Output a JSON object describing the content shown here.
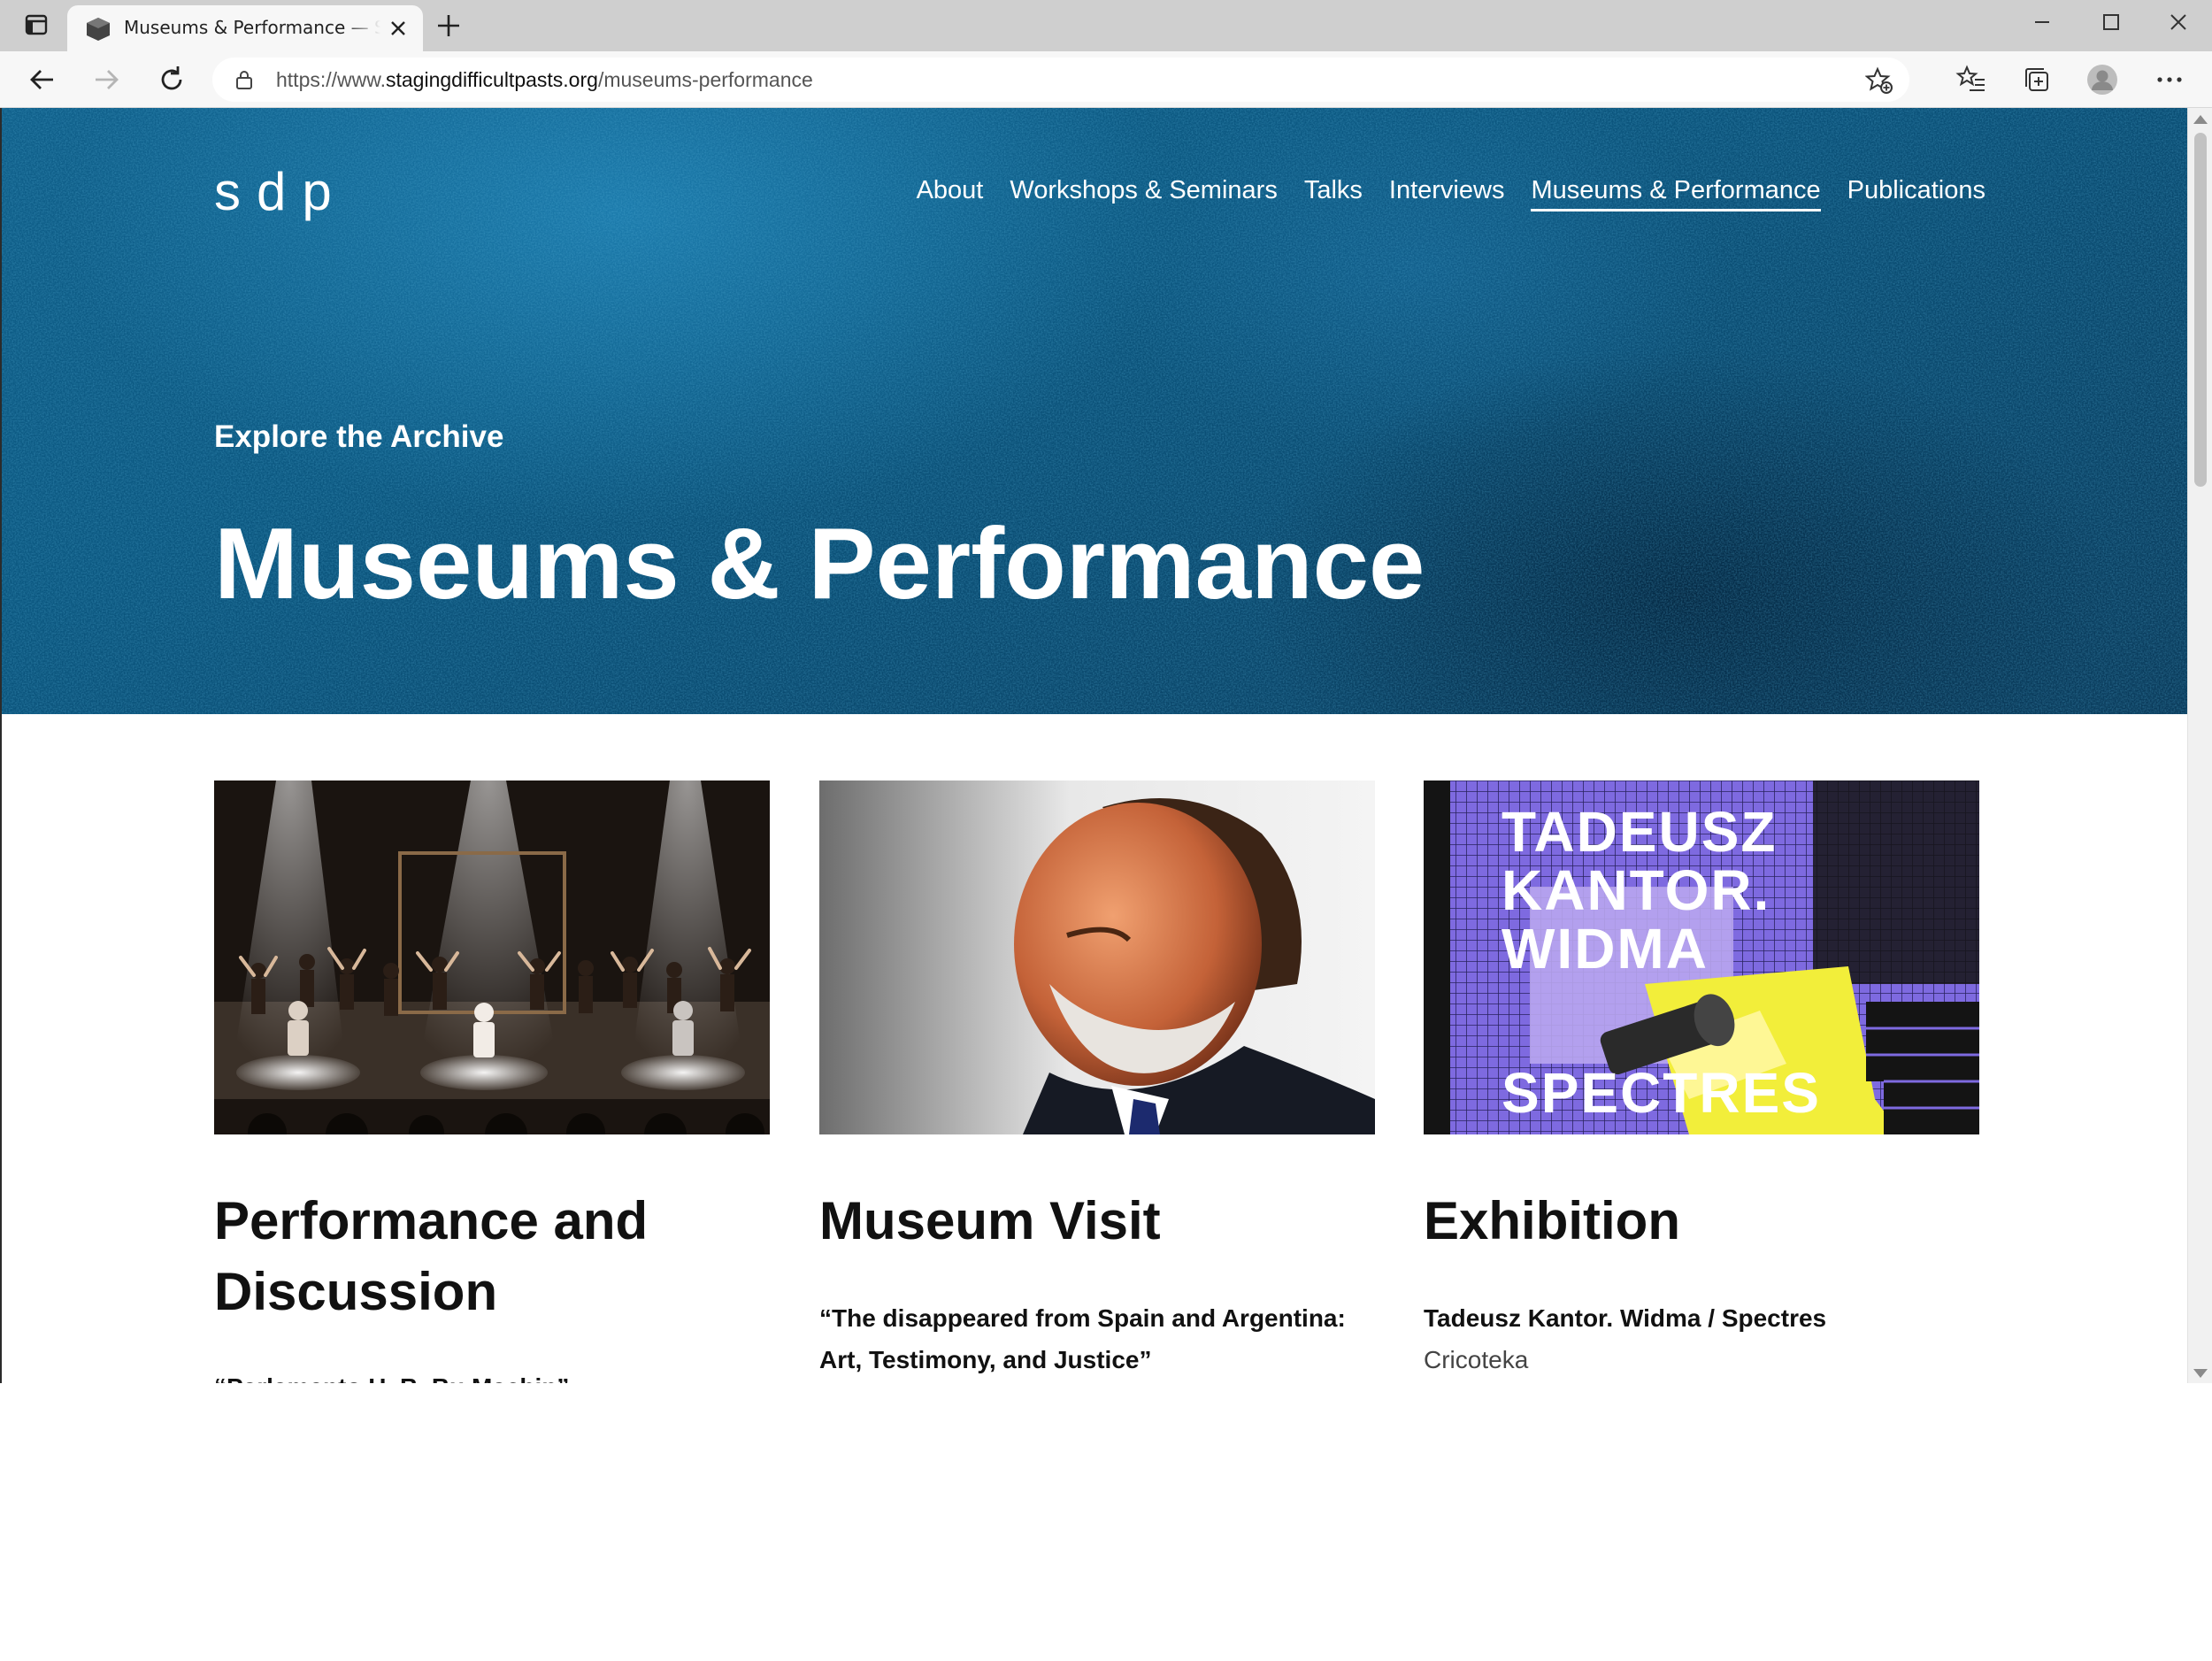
{
  "browser": {
    "tab_title": "Museums & Performance — Staging Difficult Pasts",
    "url_prefix": "https://www.",
    "url_host": "stagingdifficultpasts.org",
    "url_path": "/museums-performance"
  },
  "site": {
    "logo": "sdp",
    "nav": [
      {
        "label": "About"
      },
      {
        "label": "Workshops & Seminars"
      },
      {
        "label": "Talks"
      },
      {
        "label": "Interviews"
      },
      {
        "label": "Museums & Performance",
        "active": true
      },
      {
        "label": "Publications"
      }
    ]
  },
  "hero": {
    "eyebrow": "Explore the Archive",
    "title": "Museums & Performance"
  },
  "cards": [
    {
      "title": "Performance and Discussion",
      "subtitle": "“Parlamento H. B. Bu Machin”"
    },
    {
      "title": "Museum Visit",
      "subtitle": "“The disappeared from Spain and Argentina: Art, Testimony, and Justice”"
    },
    {
      "title": "Exhibition",
      "subtitle": "Tadeusz Kantor. Widma / Spectres",
      "meta": "Cricoteka",
      "poster_text": [
        "TADEUSZ",
        "KANTOR.",
        "WIDMA",
        "SPECTRES"
      ]
    }
  ],
  "colors": {
    "hero_blue": "#0b5780",
    "poster_purple": "#7e6ae0",
    "poster_yellow": "#f2ee3a"
  }
}
